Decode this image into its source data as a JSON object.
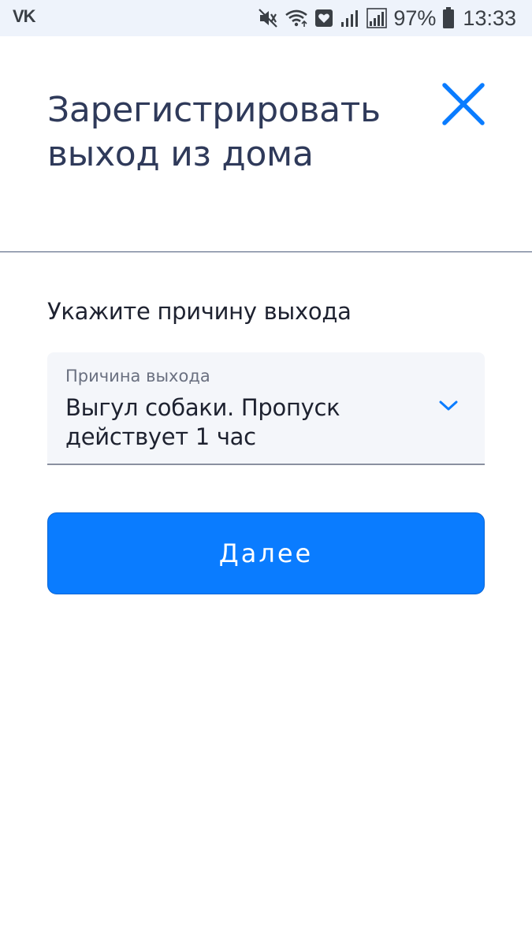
{
  "status_bar": {
    "app_icon": "vk-icon",
    "app_label": "VK",
    "icons": [
      "mute-icon",
      "wifi-icon",
      "heart-icon",
      "signal-icon",
      "signal-icon",
      "battery-icon"
    ],
    "battery_percent": "97%",
    "time": "13:33"
  },
  "header": {
    "title": "Зарегистрировать выход из дома",
    "close_icon": "close-icon"
  },
  "form": {
    "section_label": "Укажите причину выхода",
    "reason_select": {
      "label": "Причина выхода",
      "value": "Выгул собаки. Пропуск действует 1 час",
      "icon": "chevron-down-icon"
    },
    "next_button_label": "Далее"
  },
  "colors": {
    "accent": "#0a7cff",
    "title": "#2f3a5a",
    "status_bar_bg": "#eef3fb",
    "field_bg": "#f4f6fa"
  }
}
